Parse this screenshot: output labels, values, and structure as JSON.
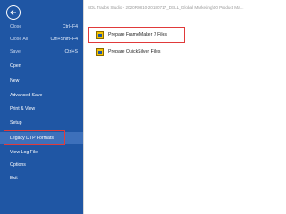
{
  "header": {
    "path_text": "SDL Trados Studio - 2020R0810-20180717_DELL_Global Marketing\\00 Product Ma..."
  },
  "sidebar": {
    "items": [
      {
        "label": "Close",
        "shortcut": "Ctrl+F4",
        "disabled": true
      },
      {
        "label": "Close All",
        "shortcut": "Ctrl+Shift+F4",
        "disabled": true
      },
      {
        "label": "Save",
        "shortcut": "Ctrl+S",
        "disabled": true
      },
      {
        "label": "Open",
        "shortcut": "",
        "disabled": false
      },
      {
        "label": "New",
        "shortcut": "",
        "disabled": false
      },
      {
        "label": "Advanced Save",
        "shortcut": "",
        "disabled": false
      },
      {
        "label": "Print & View",
        "shortcut": "",
        "disabled": false
      },
      {
        "label": "Setup",
        "shortcut": "",
        "disabled": false
      },
      {
        "label": "Legacy DTP Formats",
        "shortcut": "",
        "disabled": false,
        "selected": true
      },
      {
        "label": "View Log File",
        "shortcut": "",
        "disabled": false
      },
      {
        "label": "Options",
        "shortcut": "",
        "disabled": false
      },
      {
        "label": "Exit",
        "shortcut": "",
        "disabled": false
      }
    ]
  },
  "main": {
    "actions": [
      {
        "label": "Prepare FrameMaker 7 Files",
        "icon": "framemaker-icon"
      },
      {
        "label": "Prepare QuickSilver Files",
        "icon": "quicksilver-icon"
      }
    ]
  },
  "colors": {
    "sidebar_bg": "#1f56a4",
    "selected_bg": "#3d70bb",
    "highlight_red": "#e03a3a"
  }
}
